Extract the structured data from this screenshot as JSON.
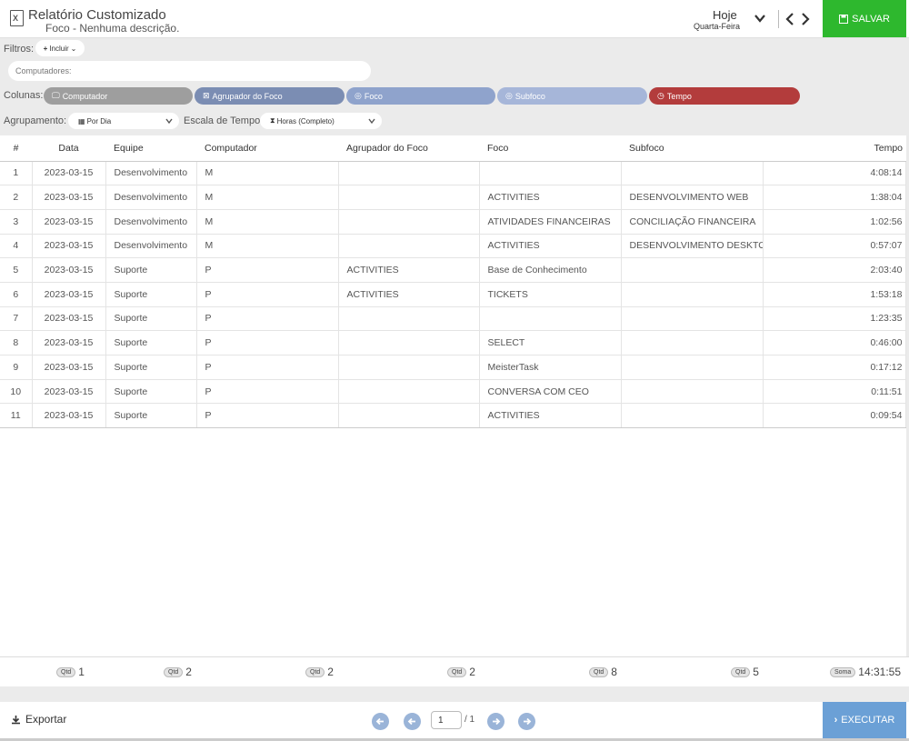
{
  "header": {
    "title": "Relatório Customizado",
    "subtitle": "Foco - Nenhuma descrição.",
    "date_label": "Hoje",
    "weekday": "Quarta-Feira",
    "save_label": "SALVAR"
  },
  "filters": {
    "label": "Filtros:",
    "include_label": "Incluir",
    "computers_placeholder": "Computadores:"
  },
  "columns": {
    "label": "Colunas:",
    "pills": [
      {
        "label": "Computador",
        "color": "#9e9e9e",
        "icon": "monitor-icon"
      },
      {
        "label": "Agrupador do Foco",
        "color": "#7b8db3",
        "icon": "group-icon"
      },
      {
        "label": "Foco",
        "color": "#8fa3cc",
        "icon": "target-icon"
      },
      {
        "label": "Subfoco",
        "color": "#a6b6d9",
        "icon": "target-icon"
      },
      {
        "label": "Tempo",
        "color": "#b33c3c",
        "icon": "clock-icon"
      }
    ]
  },
  "grouping": {
    "label": "Agrupamento:",
    "value": "Por Dia",
    "timescale_label": "Escala de Tempo:",
    "timescale_value": "Horas (Completo)"
  },
  "table": {
    "headers": [
      "#",
      "Data",
      "Equipe",
      "Computador",
      "Agrupador do Foco",
      "Foco",
      "Subfoco",
      "Tempo"
    ],
    "rows": [
      [
        "1",
        "2023-03-15",
        "Desenvolvimento",
        "M",
        "",
        "",
        "",
        "4:08:14"
      ],
      [
        "2",
        "2023-03-15",
        "Desenvolvimento",
        "M",
        "",
        "ACTIVITIES",
        "DESENVOLVIMENTO WEB",
        "1:38:04"
      ],
      [
        "3",
        "2023-03-15",
        "Desenvolvimento",
        "M",
        "",
        "ATIVIDADES FINANCEIRAS",
        "CONCILIAÇÃO FINANCEIRA",
        "1:02:56"
      ],
      [
        "4",
        "2023-03-15",
        "Desenvolvimento",
        "M",
        "",
        "ACTIVITIES",
        "DESENVOLVIMENTO DESKTOP",
        "0:57:07"
      ],
      [
        "5",
        "2023-03-15",
        "Suporte",
        "P",
        "ACTIVITIES",
        "Base de Conhecimento",
        "",
        "2:03:40"
      ],
      [
        "6",
        "2023-03-15",
        "Suporte",
        "P",
        "ACTIVITIES",
        "TICKETS",
        "",
        "1:53:18"
      ],
      [
        "7",
        "2023-03-15",
        "Suporte",
        "P",
        "",
        "",
        "",
        "1:23:35"
      ],
      [
        "8",
        "2023-03-15",
        "Suporte",
        "P",
        "",
        "SELECT",
        "",
        "0:46:00"
      ],
      [
        "9",
        "2023-03-15",
        "Suporte",
        "P",
        "",
        "MeisterTask",
        "",
        "0:17:12"
      ],
      [
        "10",
        "2023-03-15",
        "Suporte",
        "P",
        "",
        "CONVERSA COM CEO",
        "",
        "0:11:51"
      ],
      [
        "11",
        "2023-03-15",
        "Suporte",
        "P",
        "",
        "ACTIVITIES",
        "",
        "0:09:54"
      ]
    ]
  },
  "summary": {
    "qtd_label": "Qtd",
    "sum_label": "Soma",
    "items": [
      "1",
      "2",
      "2",
      "2",
      "8",
      "5"
    ],
    "total": "14:31:55"
  },
  "footer": {
    "export_label": "Exportar",
    "page_value": "1",
    "page_total": "/ 1",
    "execute_label": "EXECUTAR"
  }
}
